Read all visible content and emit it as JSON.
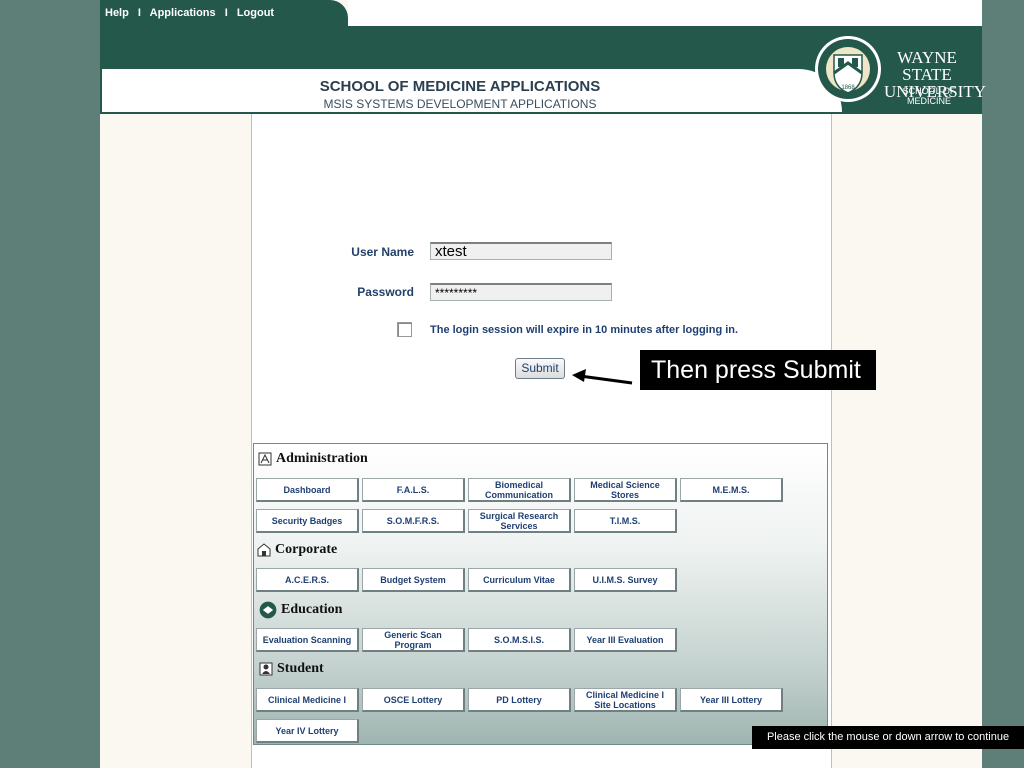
{
  "topnav": {
    "help": "Help",
    "sep1": "I",
    "applications": "Applications",
    "sep2": "I",
    "logout": "Logout"
  },
  "header": {
    "title": "SCHOOL OF MEDICINE APPLICATIONS",
    "subtitle": "MSIS SYSTEMS DEVELOPMENT APPLICATIONS"
  },
  "brand": {
    "wayne": "WAYNE STATE",
    "university": "UNIVERSITY",
    "school": "SCHOOL OF MEDICINE",
    "seal_year": "1868",
    "seal_text": "MEDICAL EDUCATION · PATIENT CARE · RESEARCH",
    "colors": {
      "primary": "#23584b",
      "gold": "#c9a64a"
    }
  },
  "login": {
    "username_label": "User Name",
    "username_value": "xtest",
    "password_label": "Password",
    "password_value": "*********",
    "session_note": "The login session will expire in 10 minutes after logging in.",
    "submit_label": "Submit"
  },
  "callout": {
    "text": "Then press Submit",
    "icon": "arrow-left-icon"
  },
  "categories": {
    "administration": {
      "title": "Administration",
      "icon": "administration-icon",
      "row1": [
        "Dashboard",
        "F.A.L.S.",
        "Biomedical Communication",
        "Medical Science Stores",
        "M.E.M.S."
      ],
      "row2": [
        "Security Badges",
        "S.O.M.F.R.S.",
        "Surgical Research Services",
        "T.I.M.S."
      ]
    },
    "corporate": {
      "title": "Corporate",
      "icon": "building-icon",
      "row1": [
        "A.C.E.R.S.",
        "Budget System",
        "Curriculum Vitae",
        "U.I.M.S. Survey"
      ]
    },
    "education": {
      "title": "Education",
      "icon": "education-icon",
      "row1": [
        "Evaluation Scanning",
        "Generic Scan Program",
        "S.O.M.S.I.S.",
        "Year III Evaluation"
      ]
    },
    "student": {
      "title": "Student",
      "icon": "student-icon",
      "row1": [
        "Clinical Medicine I",
        "OSCE Lottery",
        "PD Lottery",
        "Clinical Medicine I Site Locations",
        "Year III Lottery"
      ],
      "row2": [
        "Year IV Lottery"
      ]
    }
  },
  "footer": {
    "note": "Please click the mouse or down arrow to continue"
  }
}
